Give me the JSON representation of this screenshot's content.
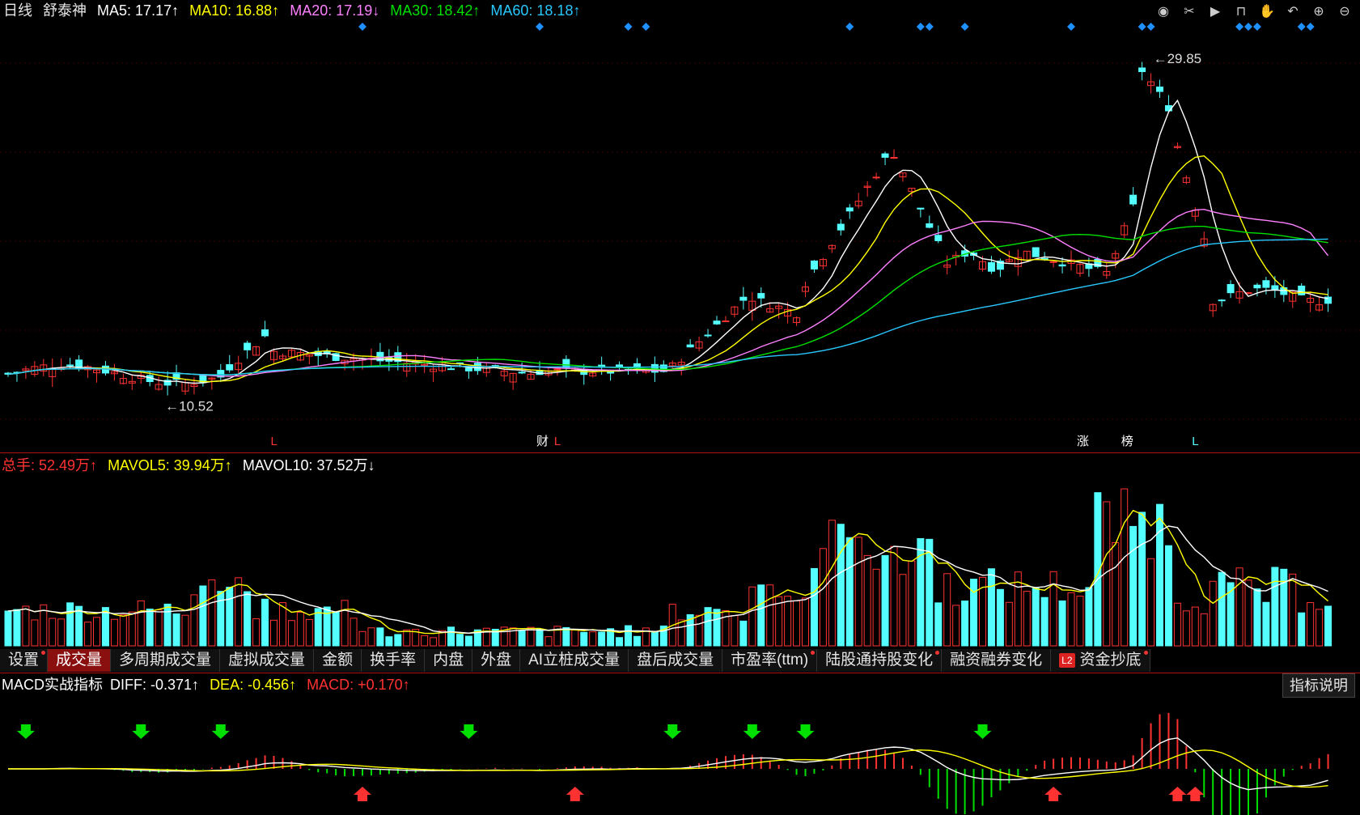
{
  "header": {
    "period": "日线",
    "stock": "舒泰神",
    "ma5": "MA5: 17.17↑",
    "ma10": "MA10: 16.88↑",
    "ma20": "MA20: 17.19↓",
    "ma30": "MA30: 18.42↑",
    "ma60": "MA60: 18.18↑"
  },
  "price_panel": {
    "high_label": "29.85",
    "low_label": "10.52",
    "markers": [
      "L",
      "财",
      "L",
      "涨",
      "榜",
      "L"
    ]
  },
  "volume_header": {
    "total": "总手: 52.49万↑",
    "mavol5": "MAVOL5: 39.94万↑",
    "mavol10": "MAVOL10: 37.52万↓"
  },
  "tabs": [
    {
      "label": "设置",
      "dot": true
    },
    {
      "label": "成交量",
      "dot": false,
      "active": true
    },
    {
      "label": "多周期成交量",
      "dot": false
    },
    {
      "label": "虚拟成交量",
      "dot": false
    },
    {
      "label": "金额",
      "dot": false
    },
    {
      "label": "换手率",
      "dot": false
    },
    {
      "label": "内盘",
      "dot": false
    },
    {
      "label": "外盘",
      "dot": false
    },
    {
      "label": "AI立桩成交量",
      "dot": false
    },
    {
      "label": "盘后成交量",
      "dot": false
    },
    {
      "label": "市盈率(ttm)",
      "dot": true
    },
    {
      "label": "陆股通持股变化",
      "dot": true
    },
    {
      "label": "融资融券变化",
      "dot": false
    },
    {
      "label": "资金抄底",
      "dot": true,
      "badge": "L2"
    }
  ],
  "macd_header": {
    "name": "MACD实战指标",
    "diff": "DIFF: -0.371↑",
    "dea": "DEA: -0.456↑",
    "macd": "MACD: +0.170↑"
  },
  "explain_button": "指标说明",
  "toolbar_icons": [
    "eye-icon",
    "scissors-icon",
    "play-icon",
    "lock-icon",
    "hand-icon",
    "undo-icon",
    "zoom-in-icon",
    "zoom-out-icon"
  ],
  "colors": {
    "up": "#ff3232",
    "down": "#54ffff",
    "ma5": "#ffffff",
    "ma10": "#ffff00",
    "ma20": "#ff80ff",
    "ma30": "#00e000",
    "ma60": "#28c8ff",
    "diamond": "#1e90ff"
  }
}
